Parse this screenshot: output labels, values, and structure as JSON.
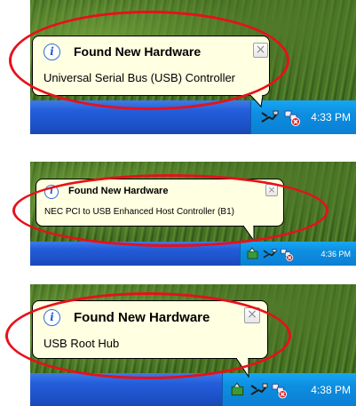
{
  "notifications": [
    {
      "title": "Found New Hardware",
      "message": "Universal Serial Bus (USB) Controller",
      "close_glyph": "×",
      "clock": "4:33 PM",
      "icons": [
        "info-icon",
        "close-icon",
        "usb-plug-icon",
        "network-error-icon"
      ]
    },
    {
      "title": "Found New Hardware",
      "message": "NEC PCI to USB Enhanced Host Controller (B1)",
      "close_glyph": "×",
      "clock": "4:36 PM",
      "icons": [
        "info-icon",
        "close-icon",
        "safely-remove-hardware-icon",
        "usb-plug-icon",
        "network-error-icon"
      ]
    },
    {
      "title": "Found New Hardware",
      "message": "USB Root Hub",
      "close_glyph": "×",
      "clock": "4:38 PM",
      "icons": [
        "info-icon",
        "close-icon",
        "safely-remove-hardware-icon",
        "usb-plug-icon",
        "network-error-icon"
      ]
    }
  ],
  "colors": {
    "balloon_bg": "#ffffe1",
    "taskbar_blue": "#245edb",
    "tray_blue": "#0e8ee0",
    "highlight_oval": "#e8101a"
  }
}
